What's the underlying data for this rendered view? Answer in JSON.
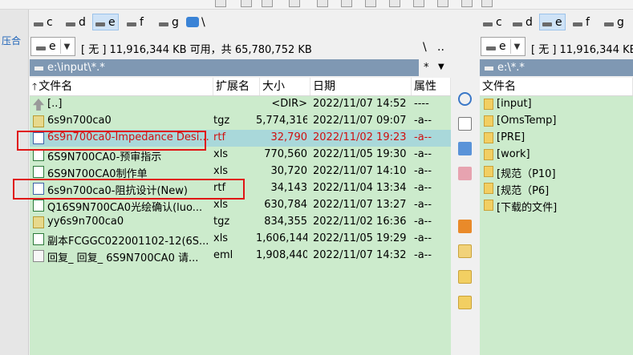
{
  "left_strip_label": "压合",
  "drive_bar_left": [
    {
      "label": "c",
      "active": false
    },
    {
      "label": "d",
      "active": false
    },
    {
      "label": "e",
      "active": true
    },
    {
      "label": "f",
      "active": false
    },
    {
      "label": "g",
      "active": false
    },
    {
      "label": "\\",
      "active": false
    }
  ],
  "drive_bar_right": [
    {
      "label": "c",
      "active": false
    },
    {
      "label": "d",
      "active": false
    },
    {
      "label": "e",
      "active": true
    },
    {
      "label": "f",
      "active": false
    },
    {
      "label": "g",
      "active": false
    }
  ],
  "left_panel": {
    "drive_combo": "e",
    "info": "[ 无 ]  11,916,344 KB 可用，共 65,780,752 KB",
    "root_btn": "\\",
    "parent_btn": "..",
    "path": "e:\\input\\*.*",
    "path_filter": "*",
    "path_dropdown": "▼",
    "headers": {
      "name": "文件名",
      "ext": "扩展名",
      "size": "大小",
      "date": "日期",
      "attr": "属性"
    },
    "rows": [
      {
        "icon": "up-folder-icon",
        "name": "[..]",
        "ext": "",
        "size": "<DIR>",
        "date": "2022/11/07 14:52",
        "attr": "----"
      },
      {
        "icon": "archive-icon",
        "name": "6s9n700ca0",
        "ext": "tgz",
        "size": "5,774,316",
        "date": "2022/11/07 09:07",
        "attr": "-a--"
      },
      {
        "icon": "word-doc-icon",
        "name": "6s9n700ca0-Impedance Desi...",
        "ext": "rtf",
        "size": "32,790",
        "date": "2022/11/02 19:23",
        "attr": "-a--",
        "selected": true
      },
      {
        "icon": "excel-icon",
        "name": "6S9N700CA0-预审指示",
        "ext": "xls",
        "size": "770,560",
        "date": "2022/11/05 19:30",
        "attr": "-a--"
      },
      {
        "icon": "excel-icon",
        "name": "6S9N700CA0制作单",
        "ext": "xls",
        "size": "30,720",
        "date": "2022/11/07 14:10",
        "attr": "-a--"
      },
      {
        "icon": "word-doc-icon",
        "name": "6s9n700ca0-阻抗设计(New)",
        "ext": "rtf",
        "size": "34,143",
        "date": "2022/11/04 13:34",
        "attr": "-a--"
      },
      {
        "icon": "excel-icon",
        "name": "Q16S9N700CA0光绘确认(luo...",
        "ext": "xls",
        "size": "630,784",
        "date": "2022/11/07 13:27",
        "attr": "-a--"
      },
      {
        "icon": "archive-icon",
        "name": "yy6s9n700ca0",
        "ext": "tgz",
        "size": "834,355",
        "date": "2022/11/02 16:36",
        "attr": "-a--"
      },
      {
        "icon": "excel-icon",
        "name": "副本FCGGC022001102-12(6S...",
        "ext": "xls",
        "size": "1,606,144",
        "date": "2022/11/05 19:29",
        "attr": "-a--"
      },
      {
        "icon": "email-icon",
        "name": "回复_ 回复_ 6S9N700CA0 请...",
        "ext": "eml",
        "size": "1,908,440",
        "date": "2022/11/07 14:32",
        "attr": "-a--"
      }
    ]
  },
  "right_panel": {
    "drive_combo": "e",
    "info": "[ 无 ]  11,916,344 KB",
    "path": "e:\\*.*",
    "headers": {
      "name": "文件名"
    },
    "rows": [
      {
        "name": "[input]"
      },
      {
        "name": "[OmsTemp]"
      },
      {
        "name": "[PRE]"
      },
      {
        "name": "[work]"
      },
      {
        "name": "[规范（P10]"
      },
      {
        "name": "[规范（P6]"
      },
      {
        "name": "[下载的文件]"
      }
    ]
  },
  "colors": {
    "list_bg": "#ccebcc",
    "selected_row_bg": "#a9d8da",
    "selected_text": "#d01010",
    "path_bar_bg": "#7f98b3",
    "highlight_box": "#e01515"
  }
}
